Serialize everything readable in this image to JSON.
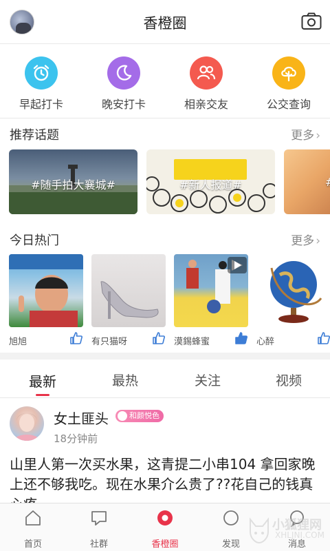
{
  "header": {
    "title": "香橙圈",
    "avatar_icon": "user-avatar",
    "camera_icon": "camera-icon"
  },
  "quick_actions": [
    {
      "label": "早起打卡",
      "icon": "alarm-clock-icon",
      "color": "#3cc3ee"
    },
    {
      "label": "晚安打卡",
      "icon": "moon-icon",
      "color": "#a46ce8"
    },
    {
      "label": "相亲交友",
      "icon": "people-icon",
      "color": "#f45a4f"
    },
    {
      "label": "公交查询",
      "icon": "tree-icon",
      "color": "#f9b418"
    }
  ],
  "topics": {
    "title": "推荐话题",
    "more": "更多",
    "items": [
      {
        "label": "#随手拍大襄城#"
      },
      {
        "label": "#新人报道#"
      },
      {
        "label": "#"
      }
    ]
  },
  "hot": {
    "title": "今日热门",
    "more": "更多",
    "items": [
      {
        "name": "旭旭"
      },
      {
        "name": "有只猫呀"
      },
      {
        "name": "漠錫蜂蜜"
      },
      {
        "name": "心醉"
      }
    ]
  },
  "feed_tabs": [
    "最新",
    "最热",
    "关注",
    "视频"
  ],
  "active_tab": "最新",
  "post": {
    "author": "女土匪头",
    "badge": "和颜悦色",
    "time": "18分钟前",
    "text": "山里人第一次买水果，这青提二小串104 拿回家晚上还不够我吃。现在水果介么贵了??花自己的钱真心疼"
  },
  "bottom_nav": [
    {
      "label": "首页",
      "icon": "home-icon"
    },
    {
      "label": "社群",
      "icon": "chat-icon"
    },
    {
      "label": "香橙圈",
      "icon": "orange-circle-icon"
    },
    {
      "label": "发现",
      "icon": "discover-icon"
    },
    {
      "label": "消息",
      "icon": "message-icon"
    }
  ],
  "active_nav": "香橙圈",
  "watermark": {
    "text": "小狐狸网",
    "sub": "XHLJNI.COM"
  },
  "colors": {
    "accent": "#e8334a",
    "badge": "#ef6aa6"
  }
}
